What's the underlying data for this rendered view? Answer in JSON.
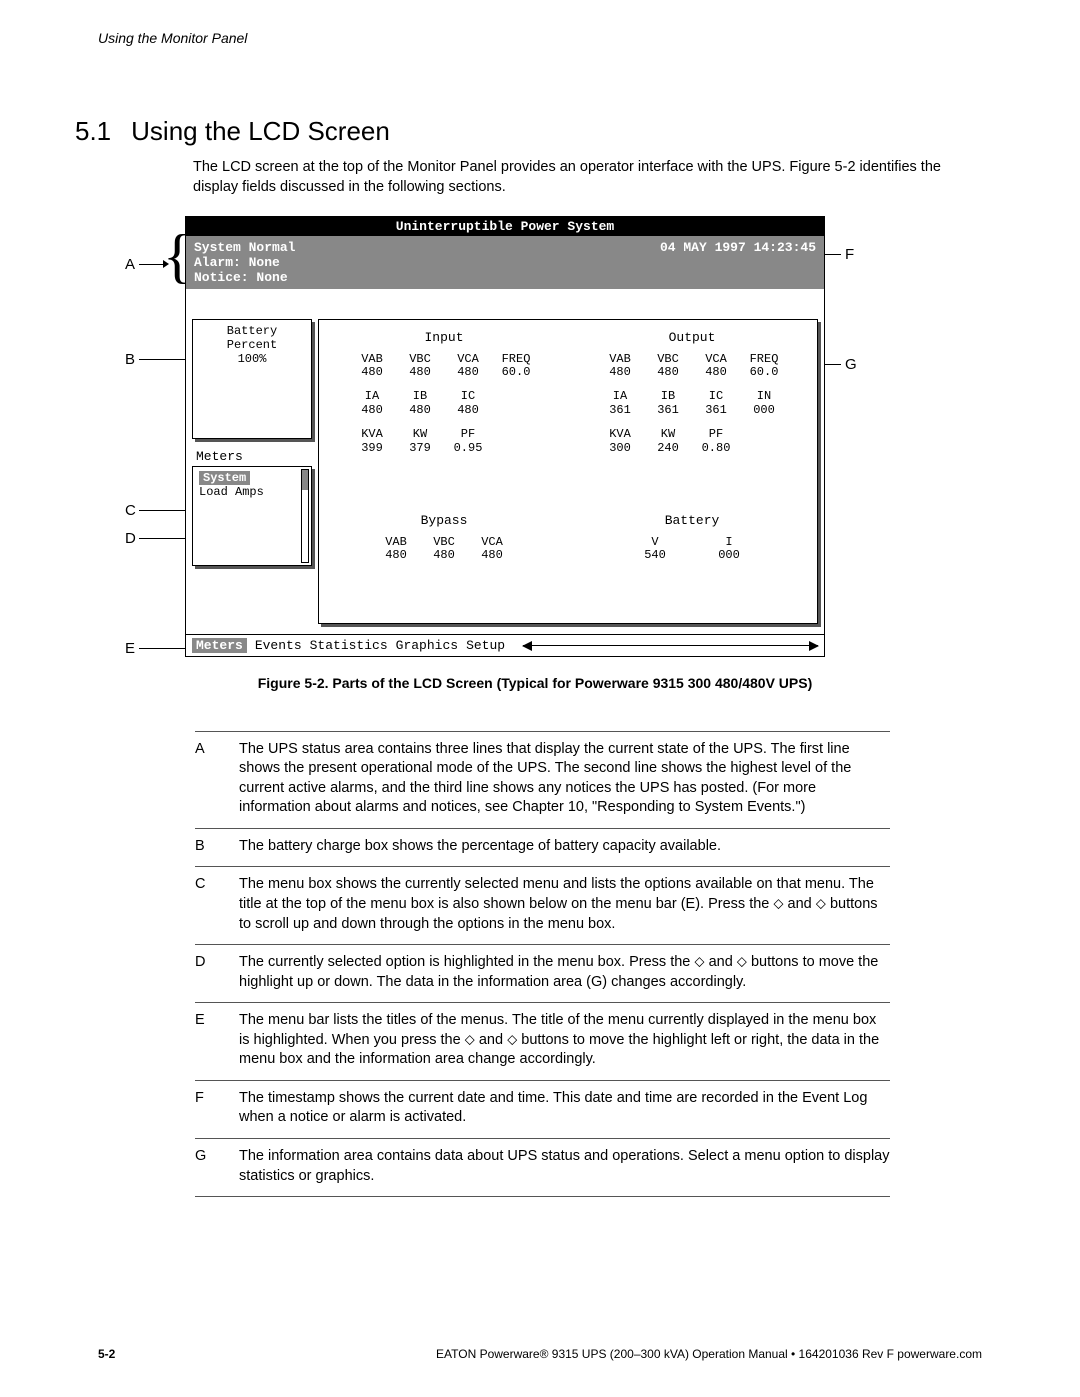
{
  "page_header": "Using the Monitor Panel",
  "section_number": "5.1",
  "section_title": "Using the LCD Screen",
  "intro": "The LCD screen at the top of the Monitor Panel provides an operator interface with the UPS. Figure 5-2 identifies the display fields discussed in the following sections.",
  "lcd": {
    "title": "Uninterruptible Power System",
    "status_line1": "System Normal",
    "status_line2": "Alarm:  None",
    "status_line3": "Notice: None",
    "timestamp": "04 MAY 1997  14:23:45",
    "battery_label1": "Battery",
    "battery_label2": "Percent",
    "battery_value": "100%",
    "menu_title": "Meters",
    "menu_selected": "System",
    "menu_item2": "Load Amps",
    "input": {
      "title": "Input",
      "h1": {
        "VAB": "480",
        "VBC": "480",
        "VCA": "480",
        "FREQ": "60.0"
      },
      "h2": {
        "IA": "480",
        "IB": "480",
        "IC": "480"
      },
      "h3": {
        "KVA": "399",
        "KW": "379",
        "PF": "0.95"
      }
    },
    "output": {
      "title": "Output",
      "h1": {
        "VAB": "480",
        "VBC": "480",
        "VCA": "480",
        "FREQ": "60.0"
      },
      "h2": {
        "IA": "361",
        "IB": "361",
        "IC": "361",
        "IN": "000"
      },
      "h3": {
        "KVA": "300",
        "KW": "240",
        "PF": "0.80"
      }
    },
    "bypass": {
      "title": "Bypass",
      "h1": {
        "VAB": "480",
        "VBC": "480",
        "VCA": "480"
      }
    },
    "battery": {
      "title": "Battery",
      "h1": {
        "V": "540",
        "I": "000"
      }
    },
    "menubar": [
      "Meters",
      "Events",
      "Statistics",
      "Graphics",
      "Setup"
    ],
    "menubar_selected": "Meters"
  },
  "callouts": {
    "A": "A",
    "B": "B",
    "C": "C",
    "D": "D",
    "E": "E",
    "F": "F",
    "G": "G"
  },
  "figure_caption": "Figure 5-2. Parts of the LCD Screen (Typical for Powerware 9315 300 480/480V UPS)",
  "descriptions": {
    "A": "The UPS status area contains three lines that display the current state of the UPS. The first line shows the present operational mode of the UPS. The second line shows the highest level of the current active alarms, and the third line shows any notices the UPS has posted. (For more information about alarms and notices, see Chapter 10, \"Responding to System Events.\")",
    "B": "The battery charge box shows the percentage of battery capacity available.",
    "C": "The menu box shows the currently selected menu and lists the options available on that menu. The title at the top of the menu box is also shown below on the menu bar (E). Press the ⬦ and ⬦ buttons to scroll up and down through the options in the menu box.",
    "D": "The currently selected option is highlighted in the menu box. Press the ⬦ and ⬦ buttons to move the highlight up or down. The data in the information area (G) changes accordingly.",
    "E": "The menu bar lists the titles of the menus. The title of the menu currently displayed in the menu box is highlighted. When you press the ⬦ and ⬦ buttons to move the highlight left or right, the data in the menu box and the information area change accordingly.",
    "F": "The timestamp shows the current date and time. This date and time are recorded in the Event Log when a notice or alarm is activated.",
    "G": "The information area contains data about UPS status and operations. Select a menu option to display statistics or graphics."
  },
  "footer": {
    "page": "5-2",
    "text": "EATON Powerware® 9315 UPS (200–300 kVA) Operation Manual  •  164201036 Rev F  powerware.com"
  }
}
